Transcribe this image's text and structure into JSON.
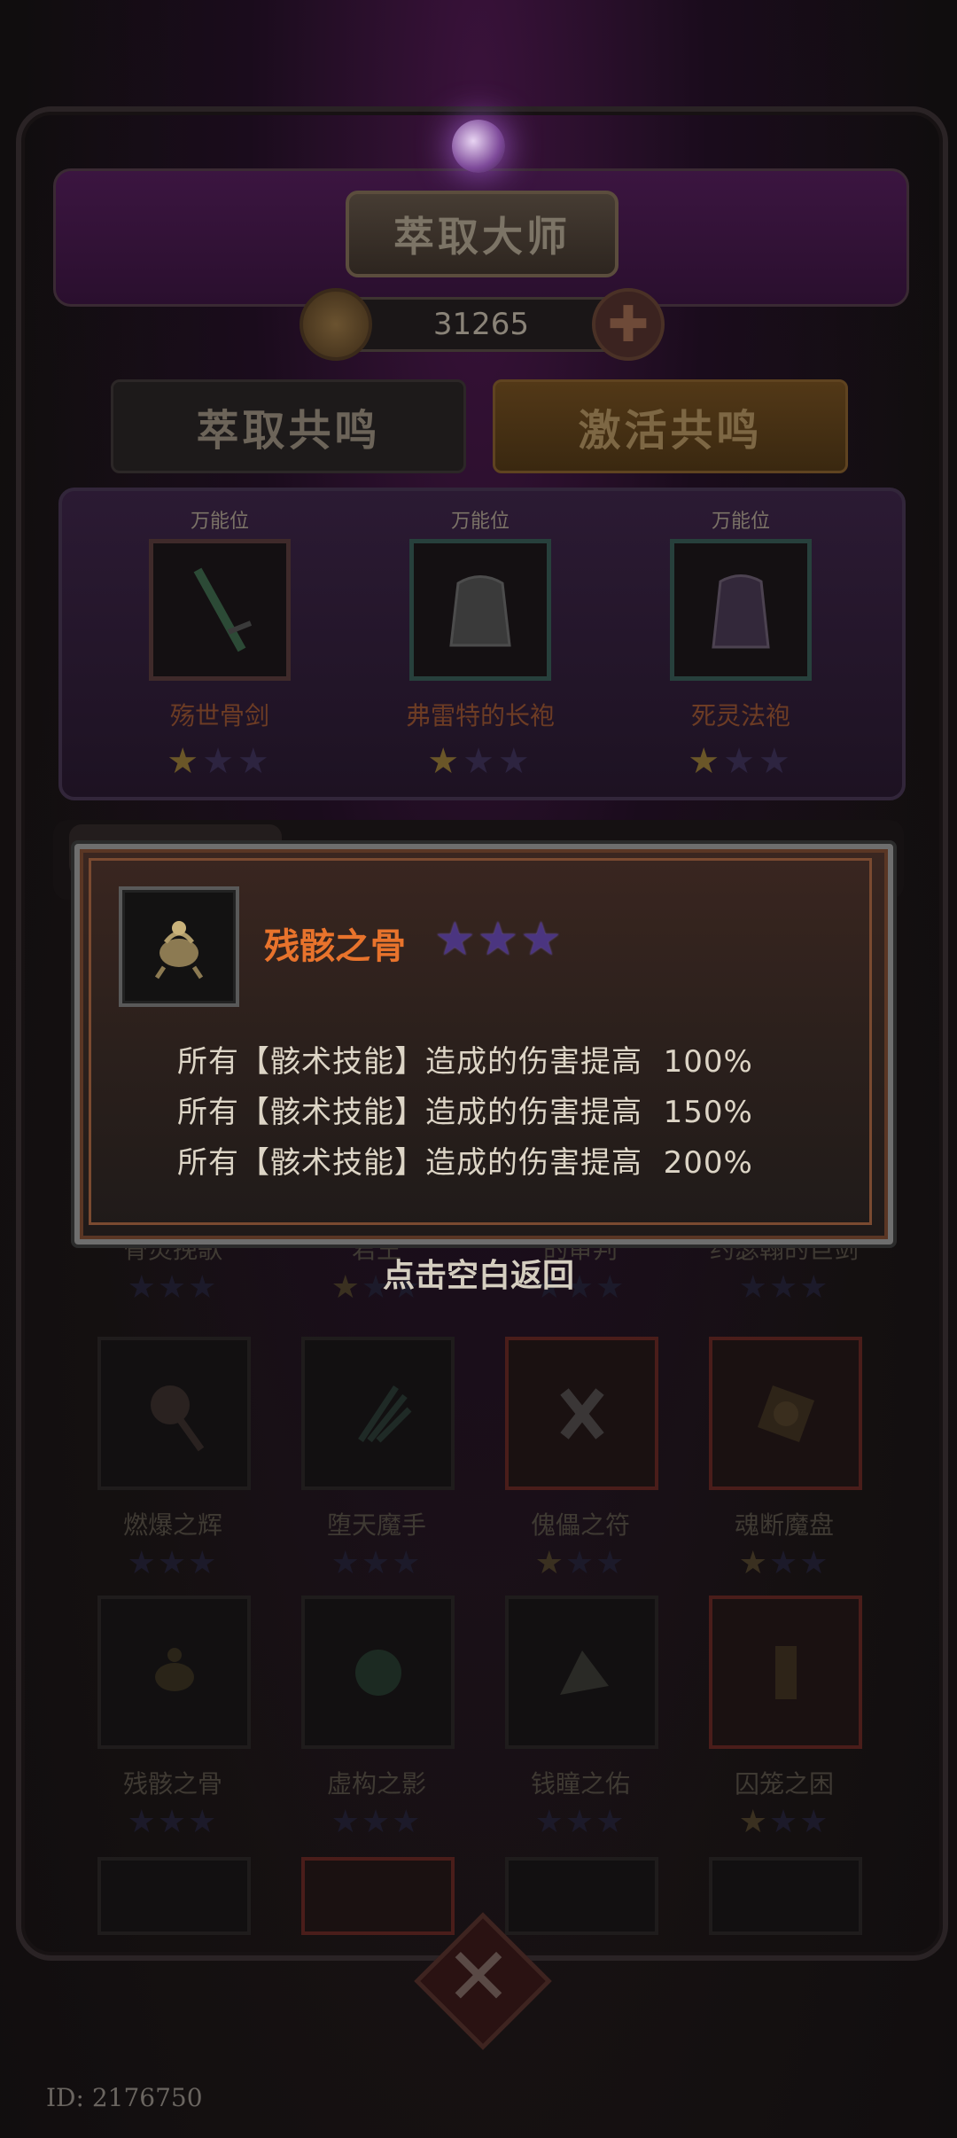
{
  "header": {
    "title": "萃取大师",
    "currency_value": "31265"
  },
  "tabs": [
    {
      "label": "萃取共鸣"
    },
    {
      "label": "激活共鸣"
    }
  ],
  "resonance_slots": [
    {
      "tag": "万能位",
      "name": "殇世骨剑",
      "stars_filled": 1,
      "stars_total": 3
    },
    {
      "tag": "万能位",
      "name": "弗雷特的长袍",
      "stars_filled": 1,
      "stars_total": 3
    },
    {
      "tag": "万能位",
      "name": "死灵法袍",
      "stars_filled": 1,
      "stars_total": 3
    }
  ],
  "items": [
    {
      "name": "骨灵挽歌",
      "stars_filled": 0
    },
    {
      "name": "君王",
      "stars_filled": 1
    },
    {
      "name": "的审判",
      "stars_filled": 0
    },
    {
      "name": "约瑟翰的巨剑",
      "stars_filled": 0
    },
    {
      "name": "燃爆之辉",
      "stars_filled": 0
    },
    {
      "name": "堕天魔手",
      "stars_filled": 0
    },
    {
      "name": "傀儡之符",
      "stars_filled": 1
    },
    {
      "name": "魂断魔盘",
      "stars_filled": 1
    },
    {
      "name": "残骸之骨",
      "stars_filled": 0
    },
    {
      "name": "虚构之影",
      "stars_filled": 0
    },
    {
      "name": "钱瞳之佑",
      "stars_filled": 0
    },
    {
      "name": "囚笼之困",
      "stars_filled": 1
    }
  ],
  "tooltip": {
    "title": "残骸之骨",
    "stars_filled": 3,
    "lines": [
      "所有【骸术技能】造成的伤害提高  100%",
      "所有【骸术技能】造成的伤害提高  150%",
      "所有【骸术技能】造成的伤害提高  200%"
    ]
  },
  "hint": "点击空白返回",
  "footer": {
    "id_text": "ID: 2176750"
  },
  "colors": {
    "tooltip_title": "#e8732c",
    "star_purple": "#4b3580"
  },
  "icons": [
    "coin-icon",
    "plus-icon",
    "close-icon",
    "bone-relic-icon"
  ]
}
